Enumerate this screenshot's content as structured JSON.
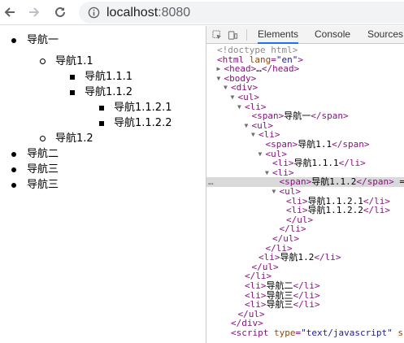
{
  "browser": {
    "url_host": "localhost",
    "url_port": ":8080"
  },
  "page": {
    "items": [
      {
        "label": "导航一",
        "bullet": "disc"
      },
      {
        "label": "导航1.1",
        "bullet": "circle"
      },
      {
        "label": "导航1.1.1",
        "bullet": "square"
      },
      {
        "label": "导航1.1.2",
        "bullet": "square"
      },
      {
        "label": "导航1.1.2.1",
        "bullet": "square"
      },
      {
        "label": "导航1.1.2.2",
        "bullet": "square"
      },
      {
        "label": "导航1.2",
        "bullet": "circle"
      },
      {
        "label": "导航二",
        "bullet": "disc"
      },
      {
        "label": "导航三",
        "bullet": "disc"
      },
      {
        "label": "导航三",
        "bullet": "disc"
      }
    ]
  },
  "devtools": {
    "tabs": [
      "Elements",
      "Console",
      "Sources"
    ],
    "active_tab": "Elements",
    "dom_lines": [
      {
        "tri": "",
        "html": "<span class='cmt'>&lt;!doctype html&gt;</span>"
      },
      {
        "tri": "",
        "html": "<span class='tag'>&lt;html</span> <span class='attr'>lang</span><span class='tag'>=</span><span class='val'>\"en\"</span><span class='tag'>&gt;</span>"
      },
      {
        "tri": "▶",
        "html": "<span class='tag'>&lt;head&gt;</span><span class='txt'>…</span><span class='tag'>&lt;/head&gt;</span>"
      },
      {
        "tri": "▼",
        "html": "<span class='tag'>&lt;body&gt;</span>"
      },
      {
        "tri": "▼",
        "html": "<span class='tag'>&lt;div&gt;</span>"
      },
      {
        "tri": "▼",
        "html": "<span class='tag'>&lt;ul&gt;</span>"
      },
      {
        "tri": "▼",
        "html": "<span class='tag'>&lt;li&gt;</span>"
      },
      {
        "tri": "",
        "html": "<span class='tag'>&lt;span&gt;</span><span class='txt'>导航一</span><span class='tag'>&lt;/span&gt;</span>"
      },
      {
        "tri": "▼",
        "html": "<span class='tag'>&lt;ul&gt;</span>"
      },
      {
        "tri": "▼",
        "html": "<span class='tag'>&lt;li&gt;</span>"
      },
      {
        "tri": "",
        "html": "<span class='tag'>&lt;span&gt;</span><span class='txt'>导航1.1</span><span class='tag'>&lt;/span&gt;</span>"
      },
      {
        "tri": "▼",
        "html": "<span class='tag'>&lt;ul&gt;</span>"
      },
      {
        "tri": "",
        "html": "<span class='tag'>&lt;li&gt;</span><span class='txt'>导航1.1.1</span><span class='tag'>&lt;/li&gt;</span>"
      },
      {
        "tri": "▼",
        "html": "<span class='tag'>&lt;li&gt;</span>"
      },
      {
        "tri": "",
        "html": "<span class='tag'>&lt;span&gt;</span><span class='txt'>导航1.1.2</span><span class='tag'>&lt;/span&gt;</span> <span class='txt'>=</span>"
      },
      {
        "tri": "▼",
        "html": "<span class='tag'>&lt;ul&gt;</span>"
      },
      {
        "tri": "",
        "html": "<span class='tag'>&lt;li&gt;</span><span class='txt'>导航1.1.2.1</span><span class='tag'>&lt;/li&gt;</span>"
      },
      {
        "tri": "",
        "html": "<span class='tag'>&lt;li&gt;</span><span class='txt'>导航1.1.2.2</span><span class='tag'>&lt;/li&gt;</span>"
      },
      {
        "tri": "",
        "html": "<span class='tag'>&lt;/ul&gt;</span>"
      },
      {
        "tri": "",
        "html": "<span class='tag'>&lt;/li&gt;</span>"
      },
      {
        "tri": "",
        "html": "<span class='tag'>&lt;/ul&gt;</span>"
      },
      {
        "tri": "",
        "html": "<span class='tag'>&lt;/li&gt;</span>"
      },
      {
        "tri": "",
        "html": "<span class='tag'>&lt;li&gt;</span><span class='txt'>导航1.2</span><span class='tag'>&lt;/li&gt;</span>"
      },
      {
        "tri": "",
        "html": "<span class='tag'>&lt;/ul&gt;</span>"
      },
      {
        "tri": "",
        "html": "<span class='tag'>&lt;/li&gt;</span>"
      },
      {
        "tri": "",
        "html": "<span class='tag'>&lt;li&gt;</span><span class='txt'>导航二</span><span class='tag'>&lt;/li&gt;</span>"
      },
      {
        "tri": "",
        "html": "<span class='tag'>&lt;li&gt;</span><span class='txt'>导航三</span><span class='tag'>&lt;/li&gt;</span>"
      },
      {
        "tri": "",
        "html": "<span class='tag'>&lt;li&gt;</span><span class='txt'>导航三</span><span class='tag'>&lt;/li&gt;</span>"
      },
      {
        "tri": "",
        "html": "<span class='tag'>&lt;/ul&gt;</span>"
      },
      {
        "tri": "",
        "html": "<span class='tag'>&lt;/div&gt;</span>"
      },
      {
        "tri": "",
        "html": "<span class='tag'>&lt;script</span> <span class='attr'>type</span><span class='tag'>=</span><span class='val'>\"text/javascript\"</span> <span class='attr'>sr</span>"
      }
    ],
    "selected_line": 14
  },
  "colors": {
    "tag": "#881280",
    "attr": "#994500",
    "value": "#1a1aa6",
    "selected_bg": "#d9d9d9",
    "active_tab": "#1a73e8"
  },
  "icons": [
    "back-icon",
    "forward-icon",
    "reload-icon",
    "info-icon",
    "inspect-icon",
    "device-toolbar-icon"
  ]
}
